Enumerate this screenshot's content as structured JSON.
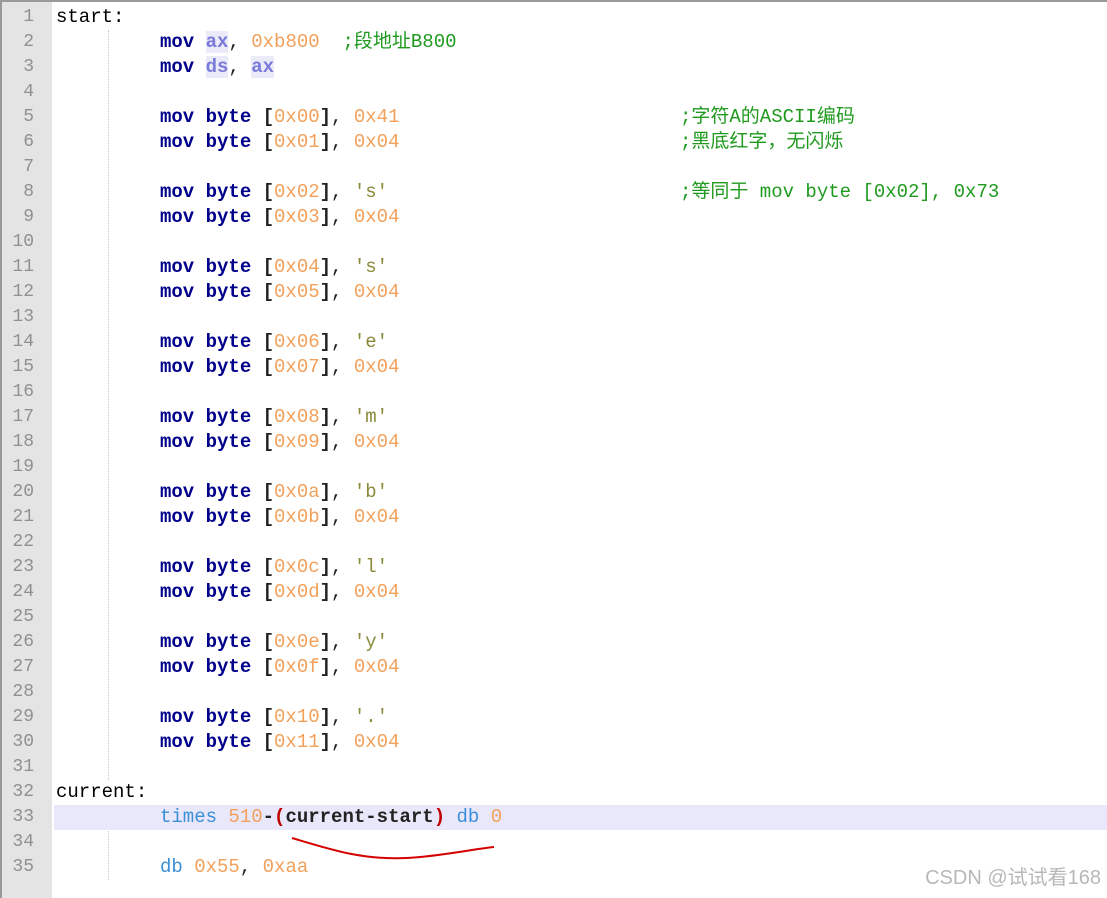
{
  "editor": {
    "lines": [
      {
        "n": "1",
        "tokens": [
          [
            "lbl",
            "start:"
          ]
        ]
      },
      {
        "n": "2",
        "tokens": [
          [
            "ind",
            ""
          ],
          [
            "k",
            "mov"
          ],
          [
            "p",
            " "
          ],
          [
            "r",
            "ax"
          ],
          [
            "p",
            ", "
          ],
          [
            "n",
            "0xb800"
          ],
          [
            "p",
            "  "
          ],
          [
            "c",
            ";段地址B800"
          ]
        ]
      },
      {
        "n": "3",
        "tokens": [
          [
            "ind",
            ""
          ],
          [
            "k",
            "mov"
          ],
          [
            "p",
            " "
          ],
          [
            "r",
            "ds"
          ],
          [
            "p",
            ", "
          ],
          [
            "r",
            "ax"
          ]
        ]
      },
      {
        "n": "4",
        "tokens": []
      },
      {
        "n": "5",
        "tokens": [
          [
            "ind",
            ""
          ],
          [
            "k",
            "mov byte"
          ],
          [
            "p",
            " "
          ],
          [
            "o",
            "["
          ],
          [
            "n",
            "0x00"
          ],
          [
            "o",
            "]"
          ],
          [
            "p",
            ", "
          ],
          [
            "n",
            "0x41"
          ],
          [
            "pad",
            ""
          ],
          [
            "c",
            ";字符A的ASCII编码"
          ]
        ]
      },
      {
        "n": "6",
        "tokens": [
          [
            "ind",
            ""
          ],
          [
            "k",
            "mov byte"
          ],
          [
            "p",
            " "
          ],
          [
            "o",
            "["
          ],
          [
            "n",
            "0x01"
          ],
          [
            "o",
            "]"
          ],
          [
            "p",
            ", "
          ],
          [
            "n",
            "0x04"
          ],
          [
            "pad",
            ""
          ],
          [
            "c",
            ";黑底红字，无闪烁"
          ]
        ]
      },
      {
        "n": "7",
        "tokens": []
      },
      {
        "n": "8",
        "tokens": [
          [
            "ind",
            ""
          ],
          [
            "k",
            "mov byte"
          ],
          [
            "p",
            " "
          ],
          [
            "o",
            "["
          ],
          [
            "n",
            "0x02"
          ],
          [
            "o",
            "]"
          ],
          [
            "p",
            ", "
          ],
          [
            "s",
            "'s'"
          ],
          [
            "pad",
            ""
          ],
          [
            "c",
            ";等同于 mov byte [0x02], 0x73"
          ]
        ]
      },
      {
        "n": "9",
        "tokens": [
          [
            "ind",
            ""
          ],
          [
            "k",
            "mov byte"
          ],
          [
            "p",
            " "
          ],
          [
            "o",
            "["
          ],
          [
            "n",
            "0x03"
          ],
          [
            "o",
            "]"
          ],
          [
            "p",
            ", "
          ],
          [
            "n",
            "0x04"
          ]
        ]
      },
      {
        "n": "10",
        "tokens": []
      },
      {
        "n": "11",
        "tokens": [
          [
            "ind",
            ""
          ],
          [
            "k",
            "mov byte"
          ],
          [
            "p",
            " "
          ],
          [
            "o",
            "["
          ],
          [
            "n",
            "0x04"
          ],
          [
            "o",
            "]"
          ],
          [
            "p",
            ", "
          ],
          [
            "s",
            "'s'"
          ]
        ]
      },
      {
        "n": "12",
        "tokens": [
          [
            "ind",
            ""
          ],
          [
            "k",
            "mov byte"
          ],
          [
            "p",
            " "
          ],
          [
            "o",
            "["
          ],
          [
            "n",
            "0x05"
          ],
          [
            "o",
            "]"
          ],
          [
            "p",
            ", "
          ],
          [
            "n",
            "0x04"
          ]
        ]
      },
      {
        "n": "13",
        "tokens": []
      },
      {
        "n": "14",
        "tokens": [
          [
            "ind",
            ""
          ],
          [
            "k",
            "mov byte"
          ],
          [
            "p",
            " "
          ],
          [
            "o",
            "["
          ],
          [
            "n",
            "0x06"
          ],
          [
            "o",
            "]"
          ],
          [
            "p",
            ", "
          ],
          [
            "s",
            "'e'"
          ]
        ]
      },
      {
        "n": "15",
        "tokens": [
          [
            "ind",
            ""
          ],
          [
            "k",
            "mov byte"
          ],
          [
            "p",
            " "
          ],
          [
            "o",
            "["
          ],
          [
            "n",
            "0x07"
          ],
          [
            "o",
            "]"
          ],
          [
            "p",
            ", "
          ],
          [
            "n",
            "0x04"
          ]
        ]
      },
      {
        "n": "16",
        "tokens": []
      },
      {
        "n": "17",
        "tokens": [
          [
            "ind",
            ""
          ],
          [
            "k",
            "mov byte"
          ],
          [
            "p",
            " "
          ],
          [
            "o",
            "["
          ],
          [
            "n",
            "0x08"
          ],
          [
            "o",
            "]"
          ],
          [
            "p",
            ", "
          ],
          [
            "s",
            "'m'"
          ]
        ]
      },
      {
        "n": "18",
        "tokens": [
          [
            "ind",
            ""
          ],
          [
            "k",
            "mov byte"
          ],
          [
            "p",
            " "
          ],
          [
            "o",
            "["
          ],
          [
            "n",
            "0x09"
          ],
          [
            "o",
            "]"
          ],
          [
            "p",
            ", "
          ],
          [
            "n",
            "0x04"
          ]
        ]
      },
      {
        "n": "19",
        "tokens": []
      },
      {
        "n": "20",
        "tokens": [
          [
            "ind",
            ""
          ],
          [
            "k",
            "mov byte"
          ],
          [
            "p",
            " "
          ],
          [
            "o",
            "["
          ],
          [
            "n",
            "0x0a"
          ],
          [
            "o",
            "]"
          ],
          [
            "p",
            ", "
          ],
          [
            "s",
            "'b'"
          ]
        ]
      },
      {
        "n": "21",
        "tokens": [
          [
            "ind",
            ""
          ],
          [
            "k",
            "mov byte"
          ],
          [
            "p",
            " "
          ],
          [
            "o",
            "["
          ],
          [
            "n",
            "0x0b"
          ],
          [
            "o",
            "]"
          ],
          [
            "p",
            ", "
          ],
          [
            "n",
            "0x04"
          ]
        ]
      },
      {
        "n": "22",
        "tokens": []
      },
      {
        "n": "23",
        "tokens": [
          [
            "ind",
            ""
          ],
          [
            "k",
            "mov byte"
          ],
          [
            "p",
            " "
          ],
          [
            "o",
            "["
          ],
          [
            "n",
            "0x0c"
          ],
          [
            "o",
            "]"
          ],
          [
            "p",
            ", "
          ],
          [
            "s",
            "'l'"
          ]
        ]
      },
      {
        "n": "24",
        "tokens": [
          [
            "ind",
            ""
          ],
          [
            "k",
            "mov byte"
          ],
          [
            "p",
            " "
          ],
          [
            "o",
            "["
          ],
          [
            "n",
            "0x0d"
          ],
          [
            "o",
            "]"
          ],
          [
            "p",
            ", "
          ],
          [
            "n",
            "0x04"
          ]
        ]
      },
      {
        "n": "25",
        "tokens": []
      },
      {
        "n": "26",
        "tokens": [
          [
            "ind",
            ""
          ],
          [
            "k",
            "mov byte"
          ],
          [
            "p",
            " "
          ],
          [
            "o",
            "["
          ],
          [
            "n",
            "0x0e"
          ],
          [
            "o",
            "]"
          ],
          [
            "p",
            ", "
          ],
          [
            "s",
            "'y'"
          ]
        ]
      },
      {
        "n": "27",
        "tokens": [
          [
            "ind",
            ""
          ],
          [
            "k",
            "mov byte"
          ],
          [
            "p",
            " "
          ],
          [
            "o",
            "["
          ],
          [
            "n",
            "0x0f"
          ],
          [
            "o",
            "]"
          ],
          [
            "p",
            ", "
          ],
          [
            "n",
            "0x04"
          ]
        ]
      },
      {
        "n": "28",
        "tokens": []
      },
      {
        "n": "29",
        "tokens": [
          [
            "ind",
            ""
          ],
          [
            "k",
            "mov byte"
          ],
          [
            "p",
            " "
          ],
          [
            "o",
            "["
          ],
          [
            "n",
            "0x10"
          ],
          [
            "o",
            "]"
          ],
          [
            "p",
            ", "
          ],
          [
            "s",
            "'.'"
          ]
        ]
      },
      {
        "n": "30",
        "tokens": [
          [
            "ind",
            ""
          ],
          [
            "k",
            "mov byte"
          ],
          [
            "p",
            " "
          ],
          [
            "o",
            "["
          ],
          [
            "n",
            "0x11"
          ],
          [
            "o",
            "]"
          ],
          [
            "p",
            ", "
          ],
          [
            "n",
            "0x04"
          ]
        ]
      },
      {
        "n": "31",
        "tokens": []
      },
      {
        "n": "32",
        "tokens": [
          [
            "lbl",
            "current:"
          ]
        ]
      },
      {
        "n": "33",
        "highlight": true,
        "tokens": [
          [
            "ind",
            ""
          ],
          [
            "t",
            "times"
          ],
          [
            "p",
            " "
          ],
          [
            "n",
            "510"
          ],
          [
            "o",
            "-"
          ],
          [
            "paren",
            "("
          ],
          [
            "o",
            "current-start"
          ],
          [
            "paren",
            ")"
          ],
          [
            "p",
            " "
          ],
          [
            "t",
            "db"
          ],
          [
            "p",
            " "
          ],
          [
            "n",
            "0"
          ]
        ]
      },
      {
        "n": "34",
        "tokens": []
      },
      {
        "n": "35",
        "tokens": [
          [
            "ind",
            ""
          ],
          [
            "t",
            "db"
          ],
          [
            "p",
            " "
          ],
          [
            "n",
            "0x55"
          ],
          [
            "p",
            ", "
          ],
          [
            "n",
            "0xaa"
          ]
        ]
      }
    ]
  },
  "watermark": "CSDN @试试看168",
  "colors": {
    "keyword": "#00008b",
    "register": "#7a7adb",
    "number": "#f2a05a",
    "comment": "#1f9a1f",
    "directive": "#3b8fd6",
    "annotation": "#d40000"
  }
}
